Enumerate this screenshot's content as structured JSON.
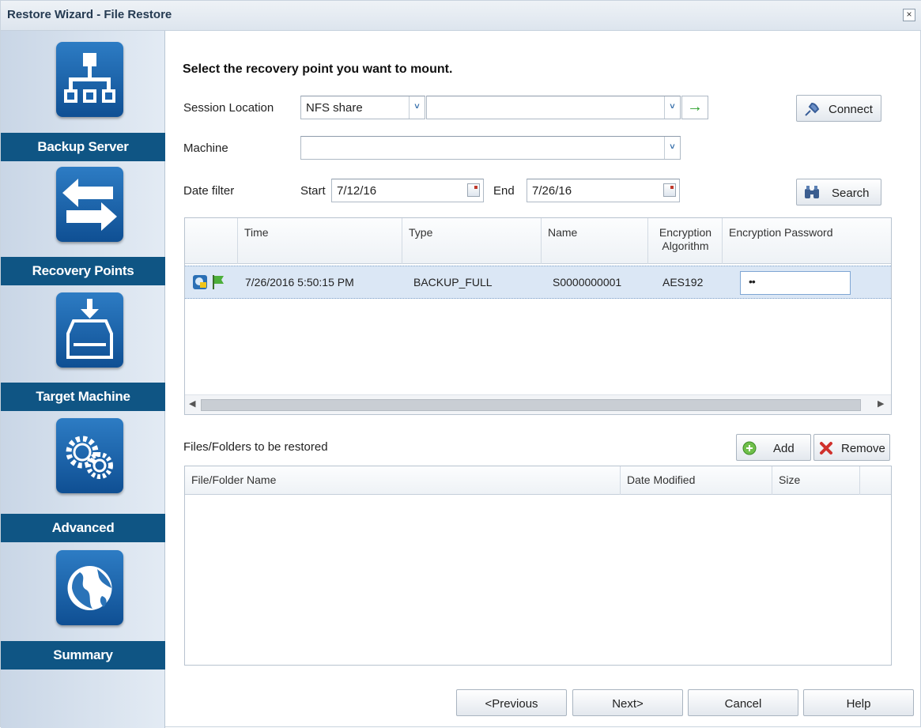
{
  "window": {
    "title": "Restore Wizard - File Restore",
    "close_glyph": "×"
  },
  "sidebar": {
    "steps": [
      {
        "label": "Backup Server",
        "icon": "network-tree-icon"
      },
      {
        "label": "Recovery Points",
        "icon": "swap-arrows-icon"
      },
      {
        "label": "Target Machine",
        "icon": "drive-download-icon"
      },
      {
        "label": "Advanced",
        "icon": "gears-icon"
      },
      {
        "label": "Summary",
        "icon": "globe-icon"
      }
    ]
  },
  "main": {
    "heading": "Select the recovery point you want to mount.",
    "session_location": {
      "label": "Session Location",
      "type_value": "NFS share",
      "path_value": ""
    },
    "machine": {
      "label": "Machine",
      "value": ""
    },
    "date_filter": {
      "label": "Date filter",
      "start_label": "Start",
      "start_value": "7/12/16",
      "end_label": "End",
      "end_value": "7/26/16"
    },
    "connect_label": "Connect",
    "search_label": "Search",
    "dropdown_glyph": "˅",
    "go_glyph": "→"
  },
  "recovery_grid": {
    "columns": [
      "Time",
      "Type",
      "Name",
      "Encryption Algorithm",
      "Encryption Password"
    ],
    "column_lines": {
      "encryption_algorithm": [
        "Encryption",
        "Algorithm"
      ]
    },
    "rows": [
      {
        "time": "7/26/2016 5:50:15 PM",
        "type": "BACKUP_FULL",
        "name": "S0000000001",
        "algorithm": "AES192",
        "password": "••"
      }
    ],
    "scroll_left": "◀",
    "scroll_right": "▶"
  },
  "files": {
    "label": "Files/Folders to be restored",
    "add_label": "Add",
    "remove_label": "Remove",
    "columns": [
      "File/Folder Name",
      "Date Modified",
      "Size"
    ]
  },
  "footer": {
    "previous": "<Previous",
    "next": "Next>",
    "cancel": "Cancel",
    "help": "Help"
  },
  "colors": {
    "sidebar_band": "#0f5584",
    "row_selected": "#dbe7f5",
    "icon_blue": "#1a63ad"
  }
}
